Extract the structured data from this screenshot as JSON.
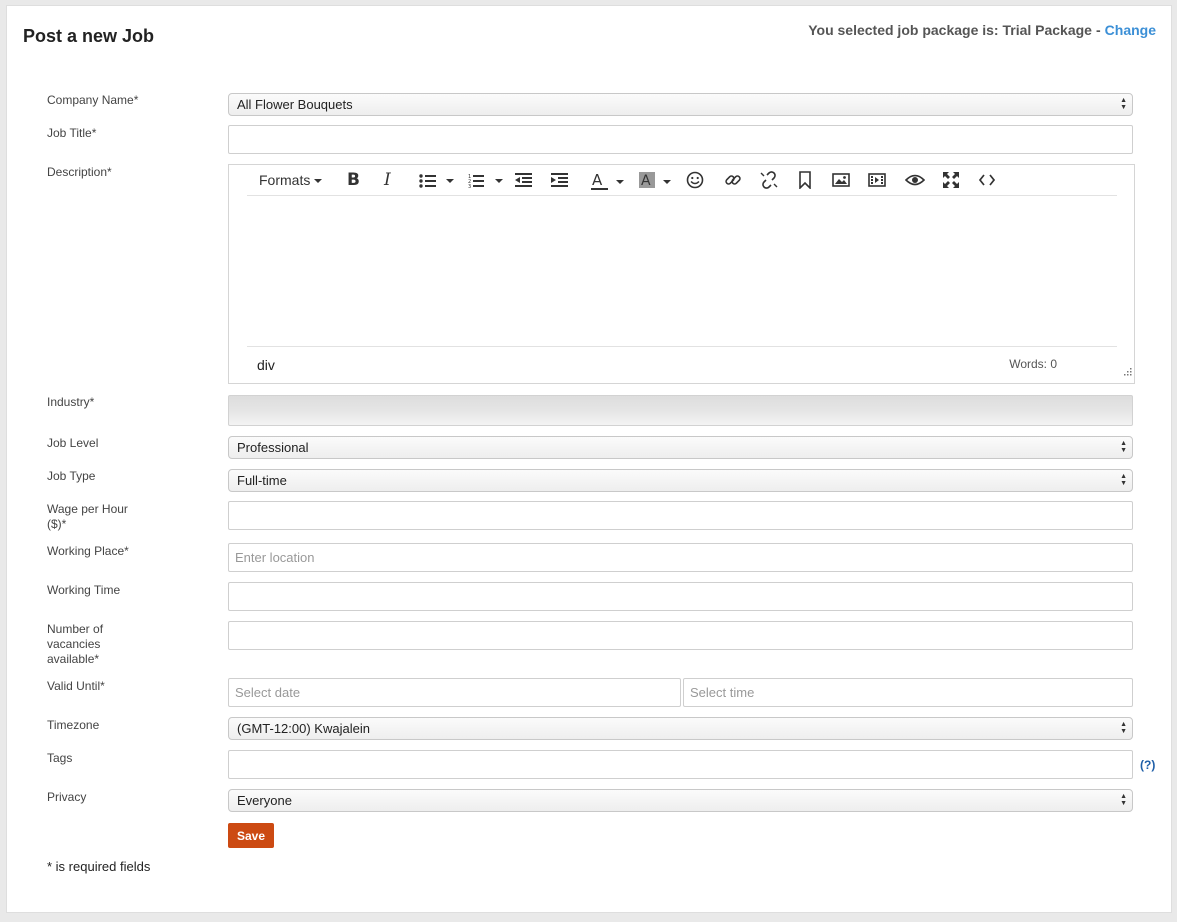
{
  "header": {
    "title": "Post a new Job",
    "package_text": "You selected job package is: Trial Package",
    "package_separator": "-",
    "change_link": "Change"
  },
  "form": {
    "company": {
      "label": "Company Name*",
      "value": "All Flower Bouquets"
    },
    "job_title": {
      "label": "Job Title*",
      "value": ""
    },
    "description": {
      "label": "Description*",
      "toolbar": {
        "formats_label": "Formats"
      },
      "status_path": "div",
      "word_count": "Words: 0"
    },
    "industry": {
      "label": "Industry*"
    },
    "job_level": {
      "label": "Job Level",
      "value": "Professional"
    },
    "job_type": {
      "label": "Job Type",
      "value": "Full-time"
    },
    "wage": {
      "label_line1": "Wage per Hour",
      "label_line2": "($)*",
      "value": ""
    },
    "working_place": {
      "label": "Working Place*",
      "placeholder": "Enter location"
    },
    "working_time": {
      "label": "Working Time",
      "value": ""
    },
    "vacancies": {
      "label_line1": "Number of",
      "label_line2": "vacancies",
      "label_line3": "available*",
      "value": ""
    },
    "valid_until": {
      "label": "Valid Until*",
      "date_placeholder": "Select date",
      "time_placeholder": "Select time"
    },
    "timezone": {
      "label": "Timezone",
      "value": "(GMT-12:00) Kwajalein"
    },
    "tags": {
      "label": "Tags",
      "help": "(?)"
    },
    "privacy": {
      "label": "Privacy",
      "value": "Everyone"
    },
    "save_label": "Save",
    "required_note": "* is required fields"
  },
  "colors": {
    "accent": "#3b8fd6",
    "save_button": "#cc4a12",
    "help_link": "#1f5fa8"
  }
}
